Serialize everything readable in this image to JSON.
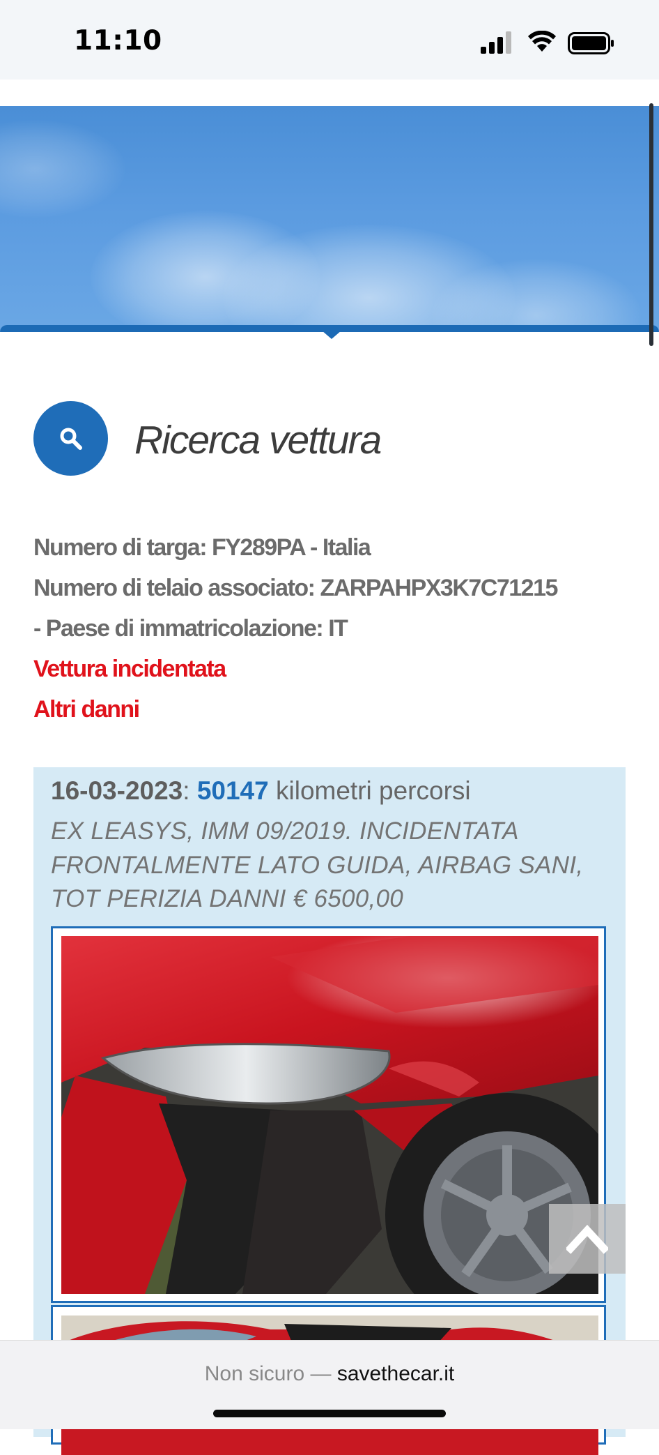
{
  "status_bar": {
    "time": "11:10"
  },
  "search_section": {
    "title": "Ricerca vettura"
  },
  "vehicle": {
    "plate_line": "Numero di targa: FY289PA - Italia",
    "vin_line": "Numero di telaio associato: ZARPAHPX3K7C71215",
    "country_line": "- Paese di immatricolazione: IT",
    "alerts": [
      "Vettura incidentata",
      "Altri danni"
    ]
  },
  "record": {
    "date": "16-03-2023",
    "separator": ":",
    "km": "50147",
    "km_suffix": "kilometri percorsi",
    "description": "EX LEASYS, IMM 09/2019. INCIDENTATA FRONTALMENTE LATO GUIDA, AIRBAG SANI, TOT PERIZIA DANNI € 6500,00"
  },
  "browser": {
    "security_label": "Non sicuro —",
    "host": "savethecar.it"
  },
  "colors": {
    "accent_blue": "#1f6db8",
    "alert_red": "#e0121b",
    "card_bg": "#d6eaf5"
  },
  "icons": [
    "signal-icon",
    "wifi-icon",
    "battery-icon",
    "search-icon",
    "chevron-up-icon"
  ]
}
